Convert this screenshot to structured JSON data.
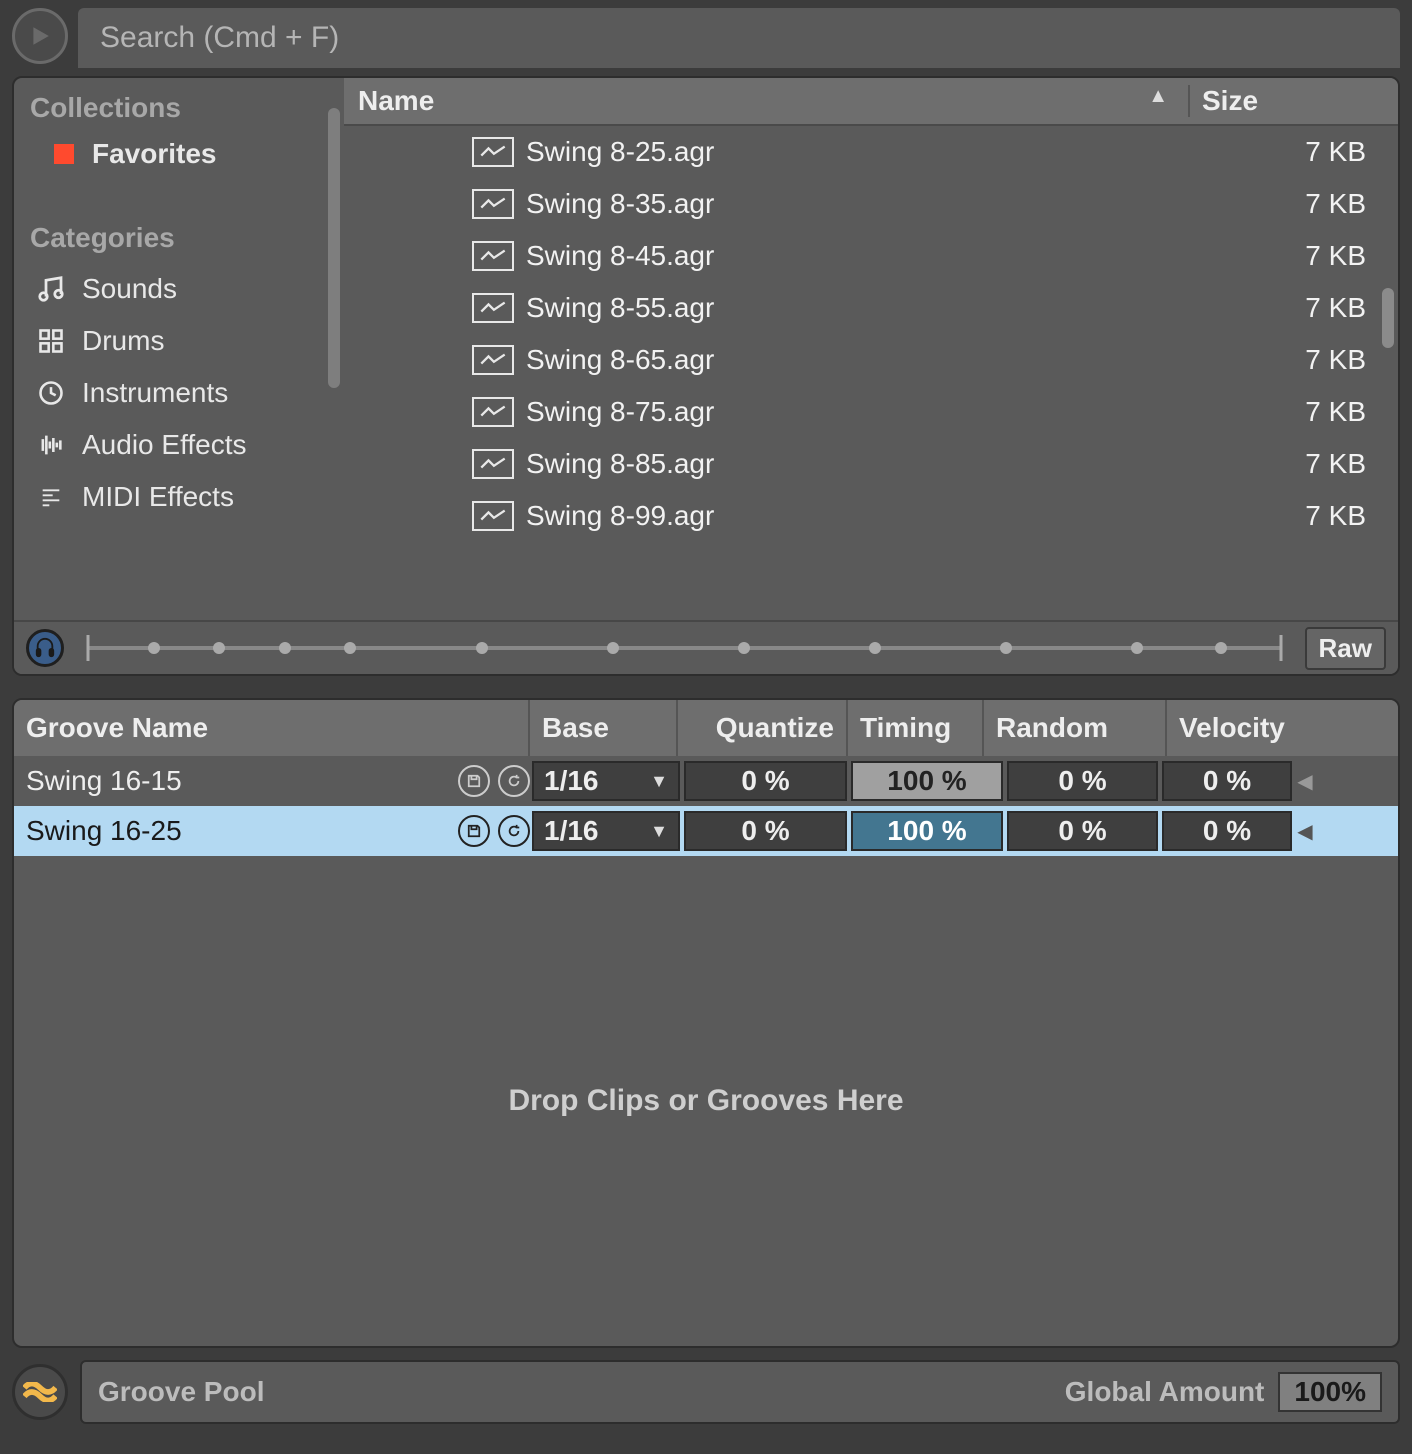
{
  "search": {
    "placeholder": "Search (Cmd + F)"
  },
  "sidebar": {
    "collections_header": "Collections",
    "favorites_label": "Favorites",
    "categories_header": "Categories",
    "items": [
      {
        "label": "Sounds"
      },
      {
        "label": "Drums"
      },
      {
        "label": "Instruments"
      },
      {
        "label": "Audio Effects"
      },
      {
        "label": "MIDI Effects"
      }
    ]
  },
  "filelist": {
    "col_name": "Name",
    "col_size": "Size",
    "rows": [
      {
        "name": "Swing 8-25.agr",
        "size": "7 KB"
      },
      {
        "name": "Swing 8-35.agr",
        "size": "7 KB"
      },
      {
        "name": "Swing 8-45.agr",
        "size": "7 KB"
      },
      {
        "name": "Swing 8-55.agr",
        "size": "7 KB"
      },
      {
        "name": "Swing 8-65.agr",
        "size": "7 KB"
      },
      {
        "name": "Swing 8-75.agr",
        "size": "7 KB"
      },
      {
        "name": "Swing 8-85.agr",
        "size": "7 KB"
      },
      {
        "name": "Swing 8-99.agr",
        "size": "7 KB"
      }
    ]
  },
  "preview": {
    "raw_label": "Raw"
  },
  "groove": {
    "headers": {
      "name": "Groove Name",
      "base": "Base",
      "quantize": "Quantize",
      "timing": "Timing",
      "random": "Random",
      "velocity": "Velocity"
    },
    "rows": [
      {
        "name": "Swing 16-15",
        "base": "1/16",
        "quantize": "0 %",
        "timing": "100 %",
        "random": "0 %",
        "velocity": "0 %",
        "selected": false
      },
      {
        "name": "Swing 16-25",
        "base": "1/16",
        "quantize": "0 %",
        "timing": "100 %",
        "random": "0 %",
        "velocity": "0 %",
        "selected": true
      }
    ],
    "drop_hint": "Drop Clips or Groove s Here",
    "drop_text": "Drop Clips or Grooves Here"
  },
  "footer": {
    "title": "Groove Pool",
    "global_label": "Global Amount",
    "global_value": "100%"
  }
}
